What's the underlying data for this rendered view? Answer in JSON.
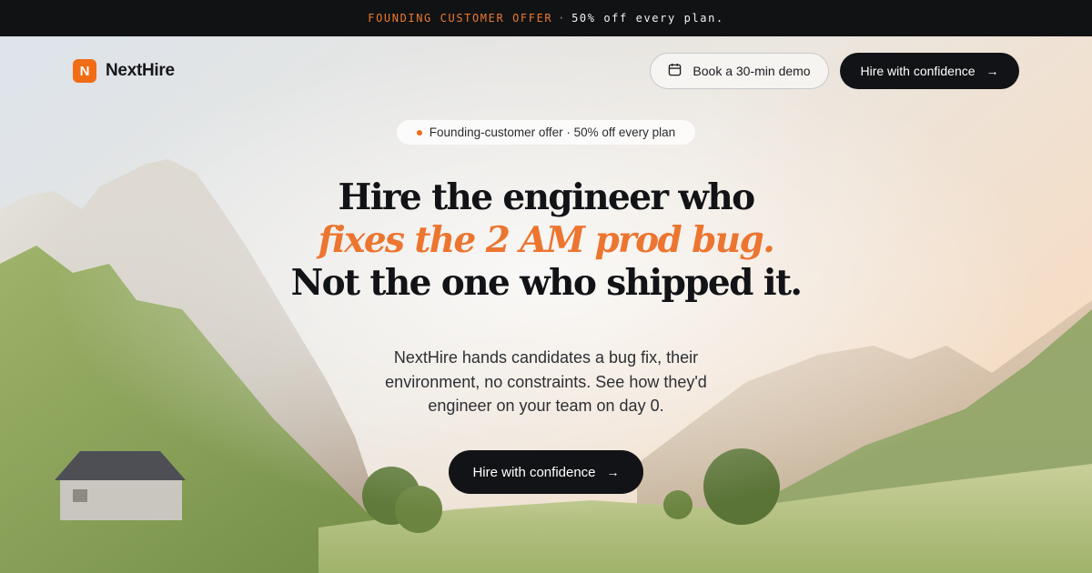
{
  "announcement": {
    "highlight": "FOUNDING CUSTOMER OFFER",
    "separator": "·",
    "text": "50% off every plan."
  },
  "brand": {
    "logo_letter": "N",
    "name": "NextHire",
    "color": "#f06d16"
  },
  "nav": {
    "demo_label": "Book a 30-min demo",
    "demo_icon": "calendar-icon",
    "cta_label": "Hire with confidence",
    "cta_icon": "arrow-right-icon"
  },
  "hero": {
    "pill_text": "Founding-customer offer · 50% off every plan",
    "headline_line1": "Hire the engineer who",
    "headline_line2": "fixes the 2 AM prod bug.",
    "headline_line3": "Not the one who shipped it.",
    "subtext": "NextHire hands candidates a bug fix, their environment, no constraints. See how they'd engineer on your team on day 0.",
    "cta_label": "Hire with confidence",
    "accent_color": "#ec7530"
  }
}
